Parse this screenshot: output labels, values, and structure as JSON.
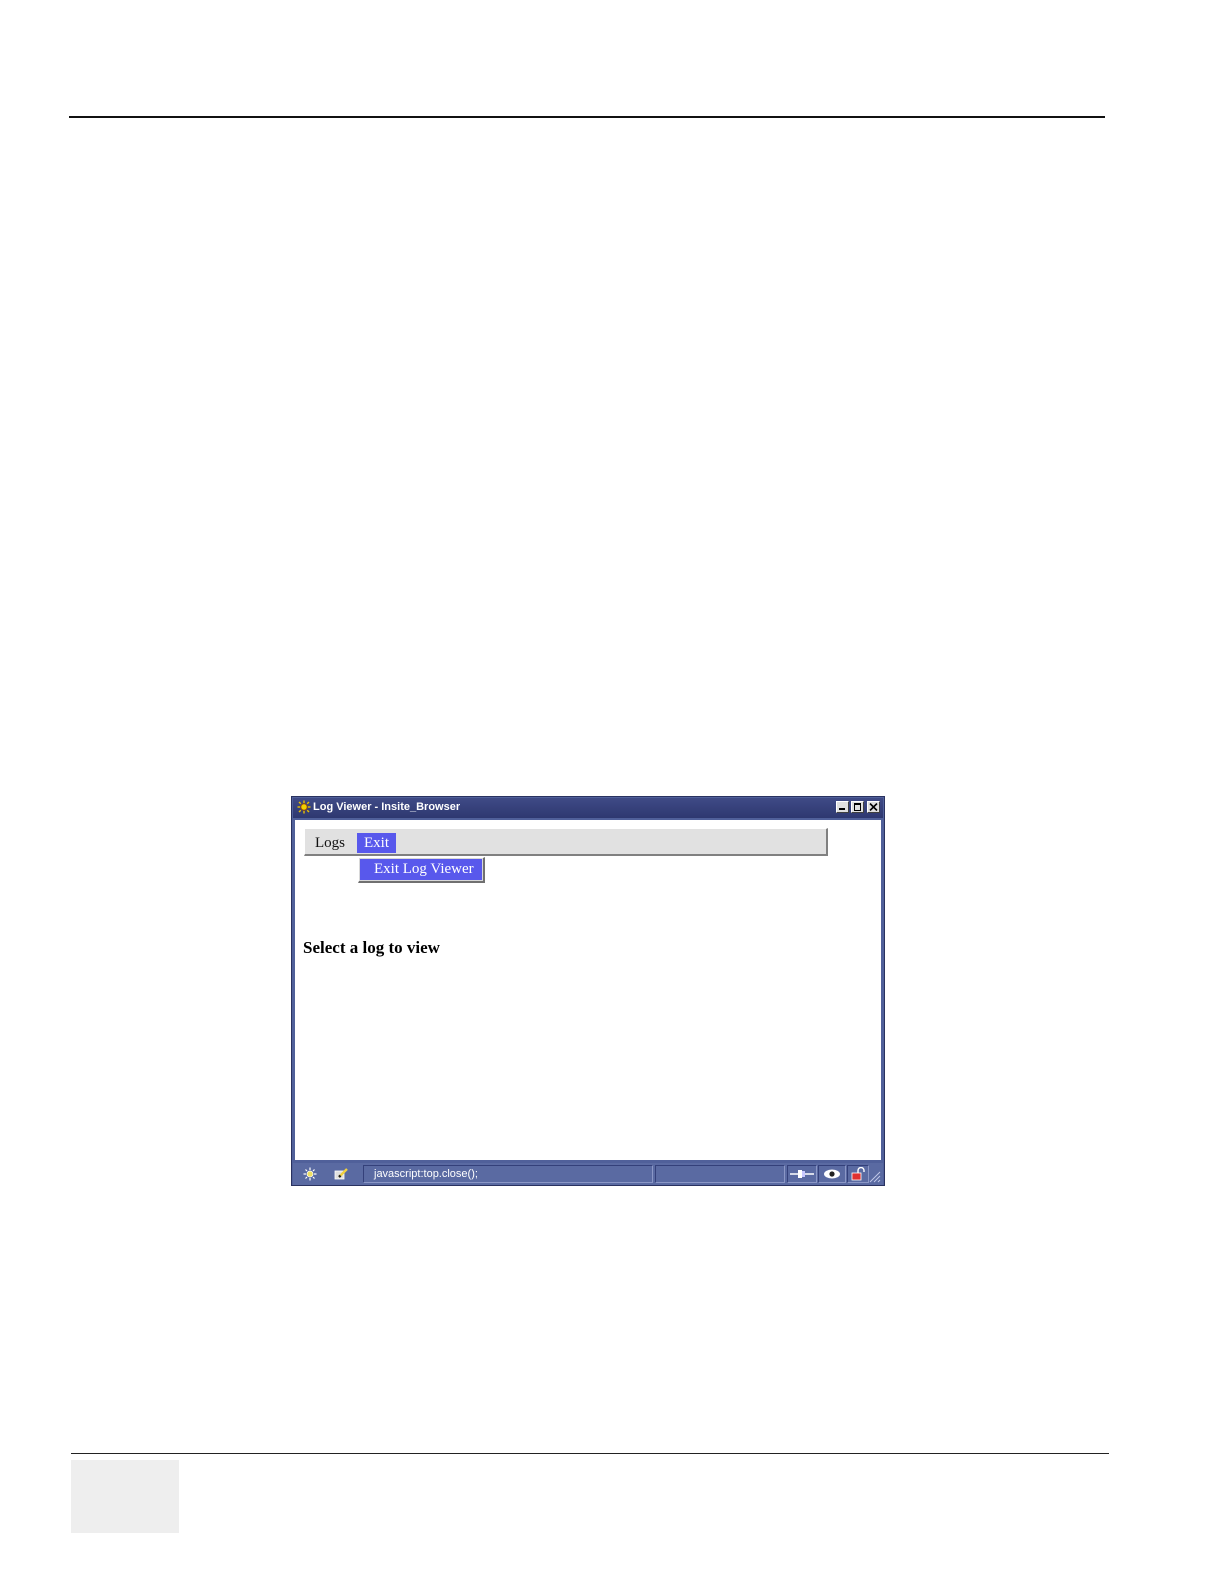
{
  "window": {
    "title": "Log Viewer - Insite_Browser"
  },
  "menubar": {
    "logs_label": "Logs",
    "exit_label": "Exit"
  },
  "exit_menu": {
    "items": [
      {
        "label": "Exit Log Viewer"
      }
    ]
  },
  "main": {
    "prompt": "Select a log to view"
  },
  "statusbar": {
    "url_text": "javascript:top.close();"
  },
  "colors": {
    "titlebar": "#2e3870",
    "frame": "#50609a",
    "menu_highlight": "#5858ec",
    "menubar_bg": "#e1e1e1"
  }
}
